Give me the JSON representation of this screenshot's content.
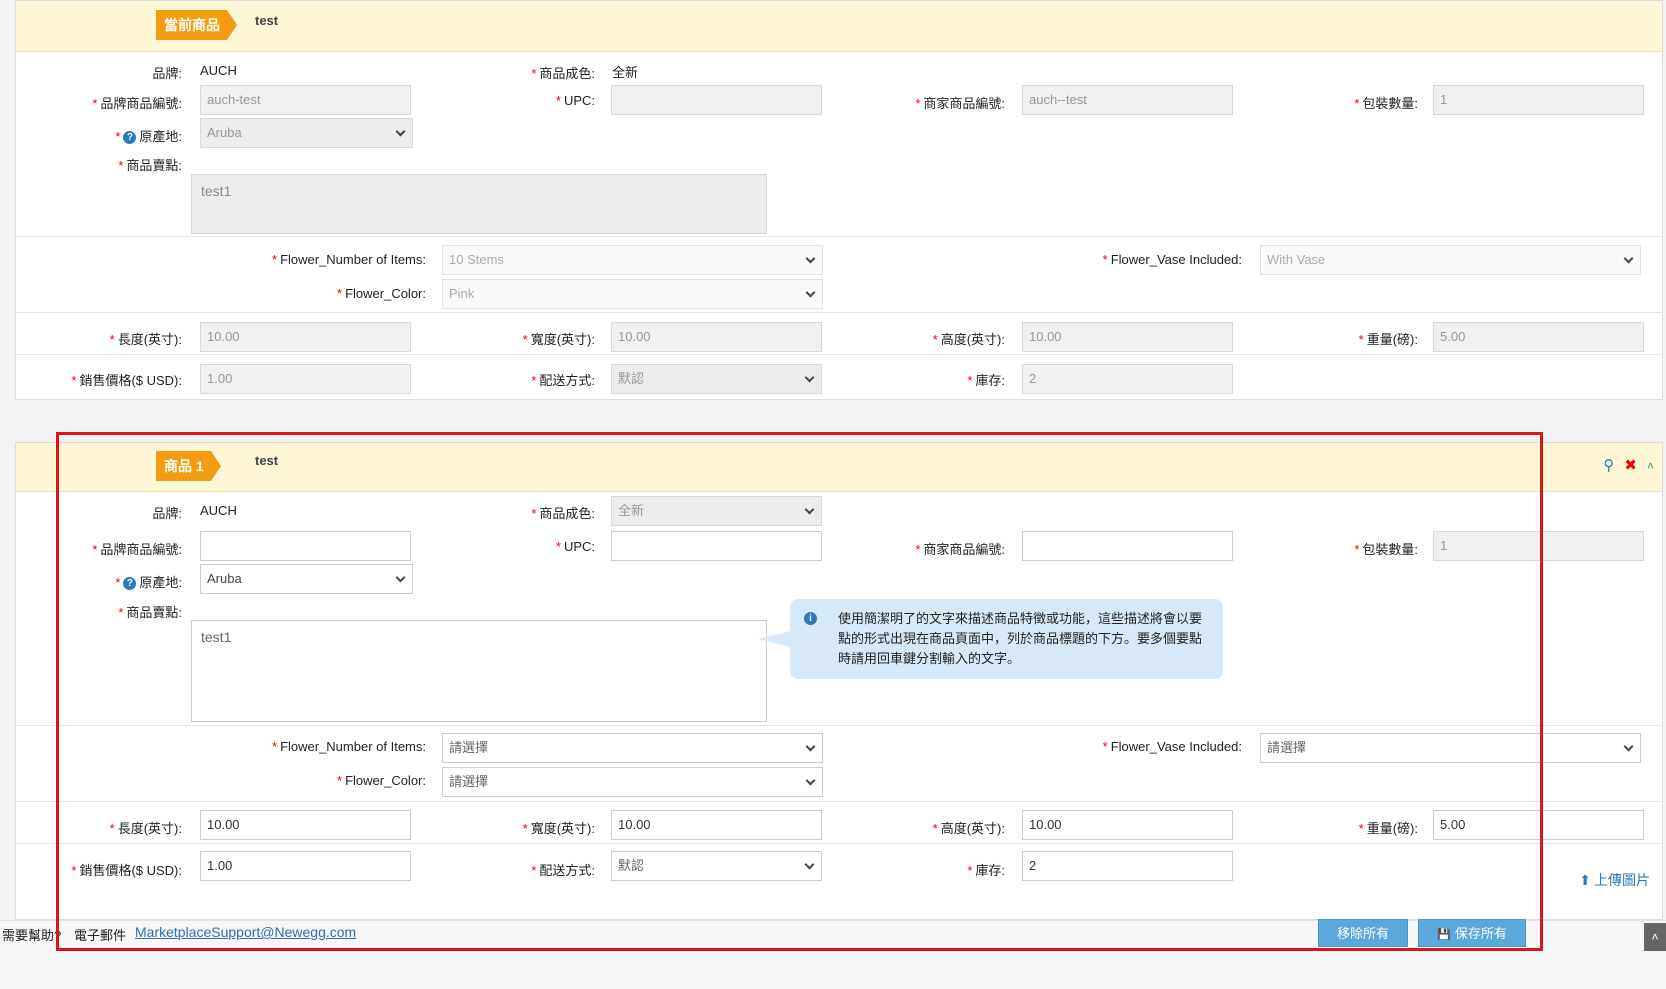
{
  "top": {
    "tag": "當前商品",
    "name": "test",
    "brand_label": "品牌:",
    "brand_value": "AUCH",
    "condition_label": "商品成色:",
    "condition_value": "全新",
    "brand_sku_label": "品牌商品編號:",
    "brand_sku_value": "auch-test",
    "upc_label": "UPC:",
    "upc_value": "",
    "seller_sku_label": "商家商品編號:",
    "seller_sku_value": "auch--test",
    "pack_qty_label": "包裝數量:",
    "pack_qty_value": "1",
    "origin_label": "原產地:",
    "origin_value": "Aruba",
    "bullets_label": "商品賣點:",
    "bullets_value": "test1",
    "num_items_label": "Flower_Number of Items:",
    "num_items_value": "10 Stems",
    "vase_label": "Flower_Vase Included:",
    "vase_value": "With Vase",
    "color_label": "Flower_Color:",
    "color_value": "Pink",
    "length_label": "長度(英寸):",
    "length_value": "10.00",
    "width_label": "寬度(英寸):",
    "width_value": "10.00",
    "height_label": "高度(英寸):",
    "height_value": "10.00",
    "weight_label": "重量(磅):",
    "weight_value": "5.00",
    "price_label": "銷售價格($ USD):",
    "price_value": "1.00",
    "shipping_label": "配送方式:",
    "shipping_value": "默認",
    "stock_label": "庫存:",
    "stock_value": "2"
  },
  "item": {
    "tag": "商品 1",
    "name": "test",
    "brand_label": "品牌:",
    "brand_value": "AUCH",
    "condition_label": "商品成色:",
    "condition_value": "全新",
    "brand_sku_label": "品牌商品編號:",
    "brand_sku_value": "",
    "upc_label": "UPC:",
    "upc_value": "",
    "seller_sku_label": "商家商品編號:",
    "seller_sku_value": "",
    "pack_qty_label": "包裝數量:",
    "pack_qty_value": "1",
    "origin_label": "原產地:",
    "origin_value": "Aruba",
    "bullets_label": "商品賣點:",
    "bullets_value": "test1",
    "tooltip": "使用簡潔明了的文字來描述商品特徵或功能，這些描述將會以要點的形式出現在商品頁面中，列於商品標題的下方。要多個要點時請用回車鍵分割輸入的文字。",
    "num_items_label": "Flower_Number of Items:",
    "num_items_value": "請選擇",
    "vase_label": "Flower_Vase Included:",
    "vase_value": "請選擇",
    "color_label": "Flower_Color:",
    "color_value": "請選擇",
    "length_label": "長度(英寸):",
    "length_value": "10.00",
    "width_label": "寬度(英寸):",
    "width_value": "10.00",
    "height_label": "高度(英寸):",
    "height_value": "10.00",
    "weight_label": "重量(磅):",
    "weight_value": "5.00",
    "price_label": "銷售價格($ USD):",
    "price_value": "1.00",
    "shipping_label": "配送方式:",
    "shipping_value": "默認",
    "stock_label": "庫存:",
    "stock_value": "2",
    "upload_label": "上傳圖片"
  },
  "footer": {
    "help": "需要幫助?",
    "email_label": "電子郵件",
    "email": "MarketplaceSupport@Newegg.com",
    "remove_all": "移除所有",
    "save_all": "保存所有"
  },
  "icons": {
    "search": "search-icon",
    "delete": "close-icon",
    "collapse": "chevron-up-icon",
    "upload": "upload-icon",
    "save": "save-icon",
    "info": "info-icon",
    "help": "question-icon"
  },
  "colors": {
    "tag": "#f39c12",
    "header_bg": "#fdf7d6",
    "button": "#5ba9dc",
    "highlight": "#d9141b",
    "tooltip_bg": "#d7e9f7"
  }
}
